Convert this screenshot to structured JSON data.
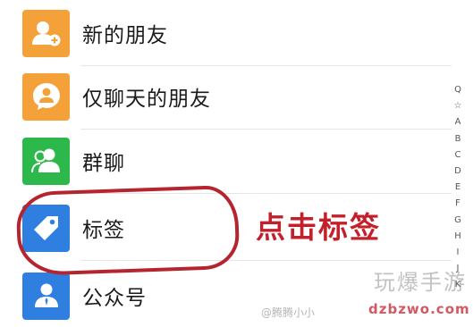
{
  "contacts_list": {
    "items": [
      {
        "label": "新的朋友",
        "icon": "add-friend-icon",
        "color": "#f5a13a"
      },
      {
        "label": "仅聊天的朋友",
        "icon": "chat-only-friend-icon",
        "color": "#f5a13a"
      },
      {
        "label": "群聊",
        "icon": "group-chat-icon",
        "color": "#2db84b"
      },
      {
        "label": "标签",
        "icon": "tag-icon",
        "color": "#2f7fe0"
      },
      {
        "label": "公众号",
        "icon": "official-account-icon",
        "color": "#2f7fe0"
      }
    ]
  },
  "alphabet_index": [
    "Q",
    "☆",
    "A",
    "B",
    "C",
    "D",
    "E",
    "F",
    "G",
    "H",
    "I",
    "J",
    "K"
  ],
  "annotation": {
    "text": "点击标签",
    "color": "#c4202c"
  },
  "watermarks": {
    "logo_text": "玩爆手游",
    "url_text": "dzbzwo.com",
    "weibo_text": "@腾腾小小"
  }
}
